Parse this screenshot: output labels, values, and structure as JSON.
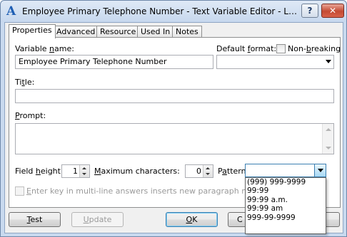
{
  "window": {
    "title": "Employee Primary Telephone Number - Text Variable Editor - Life Insu...",
    "help_label": "?",
    "close_label": "✕"
  },
  "tabs": [
    {
      "label": "Properties",
      "active": true
    },
    {
      "label": "Advanced",
      "active": false
    },
    {
      "label": "Resource",
      "active": false
    },
    {
      "label": "Used In",
      "active": false
    },
    {
      "label": "Notes",
      "active": false
    }
  ],
  "form": {
    "variable_name_label_pre": "Variable ",
    "variable_name_label_u": "n",
    "variable_name_label_post": "ame:",
    "variable_name_value": "Employee Primary Telephone Number",
    "default_format_label_pre": "Default ",
    "default_format_label_u": "f",
    "default_format_label_post": "ormat:",
    "default_format_value": "",
    "non_breaking_label_pre": "Non-",
    "non_breaking_label_u": "b",
    "non_breaking_label_post": "reaking",
    "non_breaking_checked": false,
    "title_label_pre": "Ti",
    "title_label_u": "t",
    "title_label_post": "le:",
    "title_value": "",
    "prompt_label_u": "P",
    "prompt_label_post": "rompt:",
    "prompt_value": "",
    "field_height_label_pre": "Field ",
    "field_height_label_u": "h",
    "field_height_label_post": "eight:",
    "field_height_value": "1",
    "max_chars_label_pre": "",
    "max_chars_label_u": "M",
    "max_chars_label_post": "aximum characters:",
    "max_chars_value": "0",
    "pattern_label_pre": "P",
    "pattern_label_u": "a",
    "pattern_label_post": "ttern:",
    "pattern_value": "",
    "enter_key_label_u": "E",
    "enter_key_label_post": "nter key in multi-line answers inserts new paragraph mark (¶)",
    "enter_key_checked": false
  },
  "pattern_options": [
    "(999) 999-9999",
    "99:99",
    "99:99 a.m.",
    "99:99 am",
    "999-99-9999"
  ],
  "buttons": {
    "test_u": "T",
    "test_post": "est",
    "update_u": "U",
    "update_post": "pdate",
    "ok_u": "O",
    "ok_post": "K",
    "cancel_visible": "C",
    "help_partial": ""
  }
}
